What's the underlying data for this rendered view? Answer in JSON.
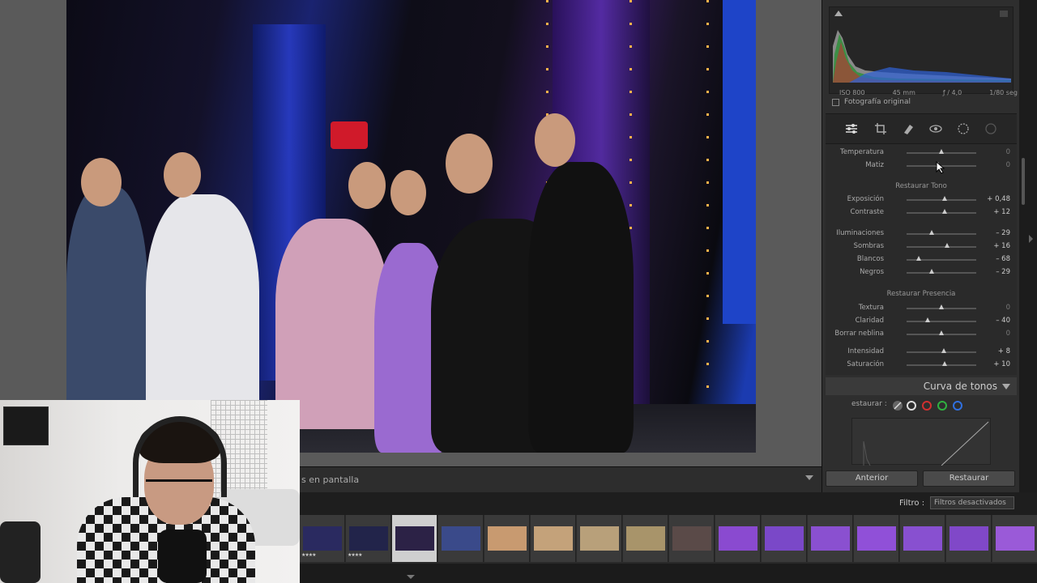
{
  "info_bar": {
    "text": "s en pantalla"
  },
  "histogram": {
    "iso": "ISO 800",
    "focal": "45 mm",
    "aperture": "ƒ / 4,0",
    "shutter": "1/80 seg",
    "original_label": "Fotografía original"
  },
  "basic": {
    "rows_top": [
      {
        "label": "Temperatura",
        "value": "0",
        "pos": 0.5,
        "dim": true
      },
      {
        "label": "Matiz",
        "value": "0",
        "pos": 0.45,
        "dim": true
      }
    ],
    "tono_title": "Restaurar Tono",
    "rows_tono": [
      {
        "label": "Exposición",
        "value": "+ 0,48",
        "pos": 0.55
      },
      {
        "label": "Contraste",
        "value": "+ 12",
        "pos": 0.55
      },
      {
        "label": "Iluminaciones",
        "value": "– 29",
        "pos": 0.36
      },
      {
        "label": "Sombras",
        "value": "+ 16",
        "pos": 0.58
      },
      {
        "label": "Blancos",
        "value": "– 68",
        "pos": 0.18
      },
      {
        "label": "Negros",
        "value": "– 29",
        "pos": 0.36
      }
    ],
    "presencia_title": "Restaurar Presencia",
    "rows_presencia": [
      {
        "label": "Textura",
        "value": "0",
        "pos": 0.5,
        "dim": true
      },
      {
        "label": "Claridad",
        "value": "– 40",
        "pos": 0.3
      },
      {
        "label": "Borrar neblina",
        "value": "0",
        "pos": 0.5,
        "dim": true
      },
      {
        "label": "Intensidad",
        "value": "+ 8",
        "pos": 0.54
      },
      {
        "label": "Saturación",
        "value": "+ 10",
        "pos": 0.55
      }
    ]
  },
  "curve": {
    "title": "Curva de tonos",
    "label": "estaurar :"
  },
  "buttons": {
    "prev": "Anterior",
    "reset": "Restaurar"
  },
  "filter": {
    "label": "Filtro :",
    "value": "Filtros desactivados"
  },
  "filmstrip": [
    {
      "color": "#2a2a60",
      "stars": "★★★★"
    },
    {
      "color": "#22244a",
      "stars": "★★★★"
    },
    {
      "color": "#2c2246",
      "stars": "",
      "selected": true
    },
    {
      "color": "#3a4a8a",
      "stars": ""
    },
    {
      "color": "#c89a70",
      "stars": ""
    },
    {
      "color": "#c4a27a",
      "stars": ""
    },
    {
      "color": "#b8a07a",
      "stars": ""
    },
    {
      "color": "#a8946a",
      "stars": ""
    },
    {
      "color": "#5a4a48",
      "stars": ""
    },
    {
      "color": "#8a4ad0",
      "stars": ""
    },
    {
      "color": "#7a48c8",
      "stars": ""
    },
    {
      "color": "#8a50d0",
      "stars": ""
    },
    {
      "color": "#9050d8",
      "stars": ""
    },
    {
      "color": "#8850d0",
      "stars": ""
    },
    {
      "color": "#8048c8",
      "stars": ""
    },
    {
      "color": "#9a5ad8",
      "stars": ""
    }
  ]
}
